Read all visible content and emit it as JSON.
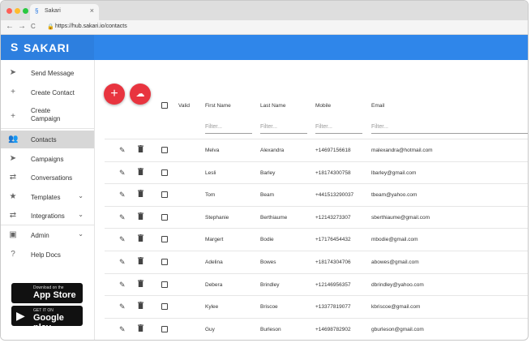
{
  "browser": {
    "tab_title": "Sakari",
    "tab_close": "×",
    "url": "https://hub.sakari.io/contacts",
    "back": "←",
    "forward": "→",
    "reload": "C",
    "lock": "🔒"
  },
  "app": {
    "logo_mark": "S",
    "logo_text": "SAKARI"
  },
  "sidebar": {
    "items": [
      {
        "label": "Send Message",
        "icon": "send-icon",
        "glyph": "➤"
      },
      {
        "label": "Create Contact",
        "icon": "plus-icon",
        "glyph": "+"
      },
      {
        "label": "Create\nCampaign",
        "icon": "plus-icon",
        "glyph": "+"
      },
      {
        "label": "Contacts",
        "icon": "people-icon",
        "glyph": "👥"
      },
      {
        "label": "Campaigns",
        "icon": "send-icon",
        "glyph": "➤"
      },
      {
        "label": "Conversations",
        "icon": "conversations-icon",
        "glyph": "⇄"
      },
      {
        "label": "Templates",
        "icon": "star-icon",
        "glyph": "★"
      },
      {
        "label": "Integrations",
        "icon": "swap-icon",
        "glyph": "⇄"
      },
      {
        "label": "Admin",
        "icon": "admin-icon",
        "glyph": "▣"
      },
      {
        "label": "Help Docs",
        "icon": "help-icon",
        "glyph": "?"
      }
    ],
    "chevron": "⌄",
    "app_store": {
      "small": "Download on the",
      "big": "App Store",
      "icon": ""
    },
    "google_play": {
      "small": "GET IT ON",
      "big": "Google play",
      "icon": "▶"
    }
  },
  "actions": {
    "add": "+",
    "upload": "☁"
  },
  "table": {
    "headers": {
      "valid": "Valid",
      "first_name": "First Name",
      "last_name": "Last Name",
      "mobile": "Mobile",
      "email": "Email"
    },
    "filter_placeholder": "Filter...",
    "edit_glyph": "✎",
    "rows": [
      {
        "first": "Melva",
        "last": "Alexandra",
        "mobile": "+14697156618",
        "email": "malexandra@hotmail.com"
      },
      {
        "first": "Lesli",
        "last": "Barley",
        "mobile": "+18174300758",
        "email": "lbarley@gmail.com"
      },
      {
        "first": "Tom",
        "last": "Beam",
        "mobile": "+441513290037",
        "email": "tbeam@yahoo.com"
      },
      {
        "first": "Stephanie",
        "last": "Berthiaume",
        "mobile": "+12143273307",
        "email": "sberthiaume@gmail.com"
      },
      {
        "first": "Margert",
        "last": "Bodie",
        "mobile": "+17176454432",
        "email": "mbodie@gmail.com"
      },
      {
        "first": "Adelina",
        "last": "Bowes",
        "mobile": "+18174304706",
        "email": "abowes@gmail.com"
      },
      {
        "first": "Debera",
        "last": "Brindley",
        "mobile": "+12146956357",
        "email": "dbrindley@yahoo.com"
      },
      {
        "first": "Kylee",
        "last": "Briscoe",
        "mobile": "+13377819077",
        "email": "kbriscoe@gmail.com"
      },
      {
        "first": "Guy",
        "last": "Burleson",
        "mobile": "+14698782902",
        "email": "gburleson@gmail.com"
      }
    ]
  },
  "colors": {
    "brand_blue": "#2f86ea",
    "fab_red": "#e8343f",
    "active_nav": "#d7d7d7"
  }
}
